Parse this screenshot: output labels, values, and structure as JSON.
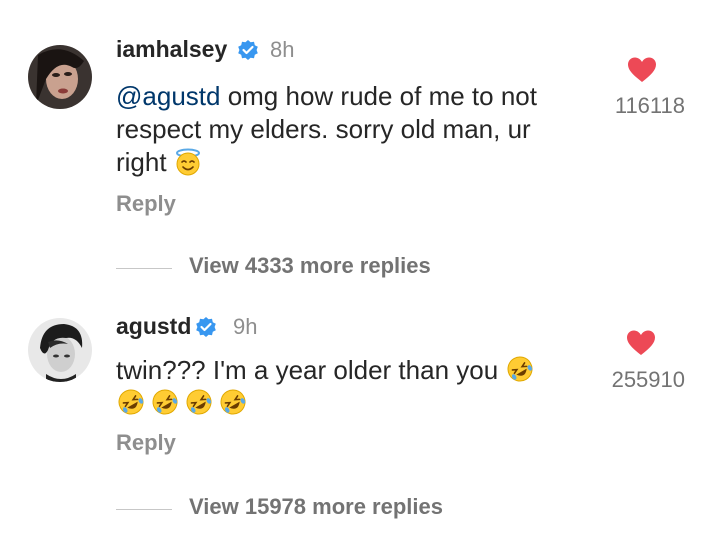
{
  "comments": [
    {
      "username": "iamhalsey",
      "time": "8h",
      "mention": "@agustd",
      "text_line1": " omg how rude of me to not",
      "text_line2": "respect my elders. sorry old man, ur",
      "text_line3": "right",
      "emoji_names": [
        "smiling-face-with-halo"
      ],
      "reply_label": "Reply",
      "likes": "116118",
      "view_replies": "View 4333 more replies"
    },
    {
      "username": "agustd",
      "time": "9h",
      "text_line1": "twin??? I'm a year older than you",
      "emoji_names": [
        "rolling-on-floor-laughing",
        "rolling-on-floor-laughing",
        "rolling-on-floor-laughing",
        "rolling-on-floor-laughing",
        "rolling-on-floor-laughing"
      ],
      "reply_label": "Reply",
      "likes": "255910",
      "view_replies": "View 15978 more replies"
    }
  ],
  "icons": {
    "verified": "verified-badge-icon",
    "like": "heart-icon"
  },
  "colors": {
    "heart": "#ed4956",
    "verified": "#3897f0",
    "mention": "#00376b",
    "secondary_text": "#8e8e8e"
  }
}
